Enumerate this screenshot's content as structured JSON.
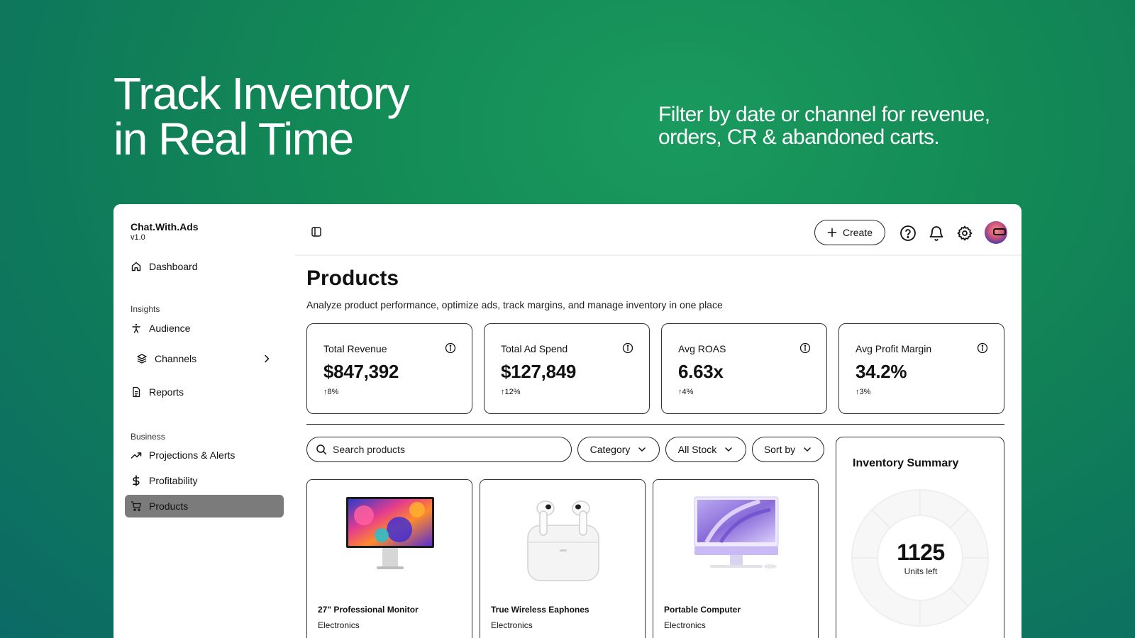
{
  "hero": {
    "title_line1": "Track Inventory",
    "title_line2": "in Real Time",
    "subtitle": "Filter by date or channel for revenue, orders, CR & abandoned carts."
  },
  "brand": {
    "name": "Chat.With.Ads",
    "version": "v1.0"
  },
  "sidebar": {
    "dashboard": "Dashboard",
    "insights_label": "Insights",
    "audience": "Audience",
    "channels": "Channels",
    "reports": "Reports",
    "business_label": "Business",
    "projections": "Projections & Alerts",
    "profitability": "Profitability",
    "products": "Products"
  },
  "topbar": {
    "create_label": "Create"
  },
  "page": {
    "title": "Products",
    "description": "Analyze product performance, optimize ads, track margins, and manage inventory in one place"
  },
  "kpis": [
    {
      "label": "Total Revenue",
      "value": "$847,392",
      "delta": "↑8%"
    },
    {
      "label": "Total Ad Spend",
      "value": "$127,849",
      "delta": "↑12%"
    },
    {
      "label": "Avg ROAS",
      "value": "6.63x",
      "delta": "↑4%"
    },
    {
      "label": "Avg Profit Margin",
      "value": "34.2%",
      "delta": "↑3%"
    }
  ],
  "filters": {
    "search_placeholder": "Search products",
    "category": "Category",
    "stock": "All Stock",
    "sort": "Sort by"
  },
  "products": [
    {
      "name": "27\" Professional Monitor",
      "category": "Electronics",
      "icon": "monitor-image"
    },
    {
      "name": "True Wireless Eaphones",
      "category": "Electronics",
      "icon": "earbuds-image"
    },
    {
      "name": "Portable Computer",
      "category": "Electronics",
      "icon": "desktop-computer-image"
    }
  ],
  "inventory": {
    "title": "Inventory Summary",
    "units": "1125",
    "units_label": "Units left"
  },
  "colors": {
    "background": "#138a55",
    "active_nav": "#7b7b7b",
    "border": "#333333"
  }
}
